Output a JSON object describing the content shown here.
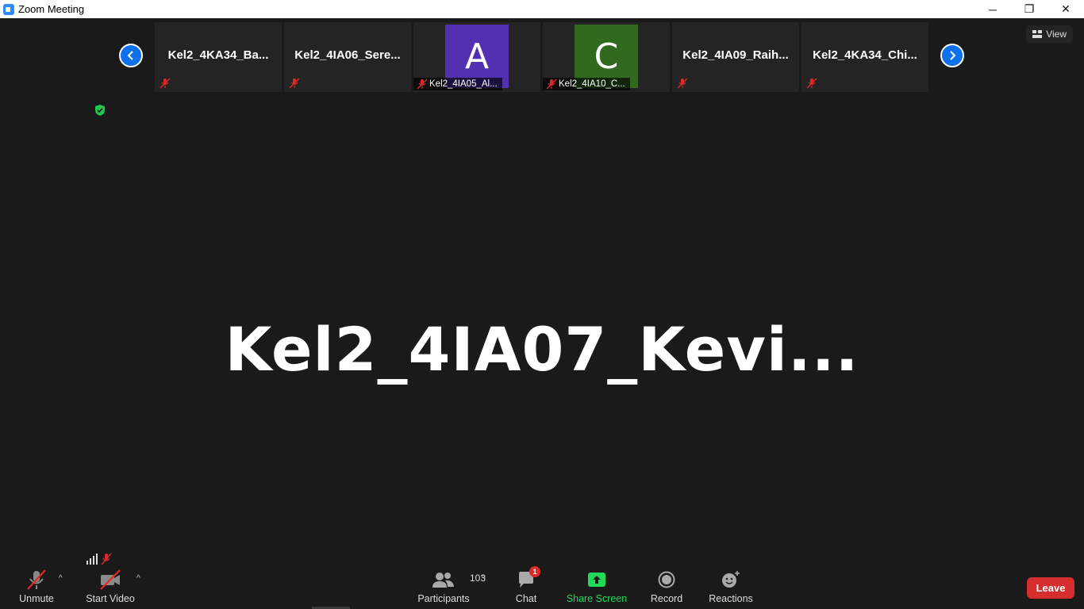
{
  "window": {
    "title": "Zoom Meeting",
    "minimize_icon": "─",
    "restore_icon": "❐",
    "close_icon": "✕"
  },
  "view_button": {
    "label": "View"
  },
  "thumbnails": [
    {
      "name": "Kel2_4KA34_Ba...",
      "type": "name"
    },
    {
      "name": "Kel2_4IA06_Sere...",
      "type": "name"
    },
    {
      "name": "Kel2_4IA05_Al...",
      "type": "avatar",
      "avatar_letter": "A",
      "avatar_color": "#5131b0"
    },
    {
      "name": "Kel2_4IA10_C...",
      "type": "avatar",
      "avatar_letter": "C",
      "avatar_color": "#316a1e"
    },
    {
      "name": "Kel2_4IA09_Raih...",
      "type": "name"
    },
    {
      "name": "Kel2_4KA34_Chi...",
      "type": "name"
    }
  ],
  "active_speaker": {
    "name": "Kel2_4IA07_Kevi..."
  },
  "toolbar": {
    "unmute_label": "Unmute",
    "start_video_label": "Start Video",
    "participants_label": "Participants",
    "participants_count": "103",
    "chat_label": "Chat",
    "chat_badge": "1",
    "share_screen_label": "Share Screen",
    "record_label": "Record",
    "reactions_label": "Reactions",
    "leave_label": "Leave",
    "caret": "^"
  },
  "colors": {
    "accent_blue": "#0e71eb",
    "share_green": "#23d959",
    "leave_red": "#d62d2d",
    "muted_red": "#e02828"
  }
}
